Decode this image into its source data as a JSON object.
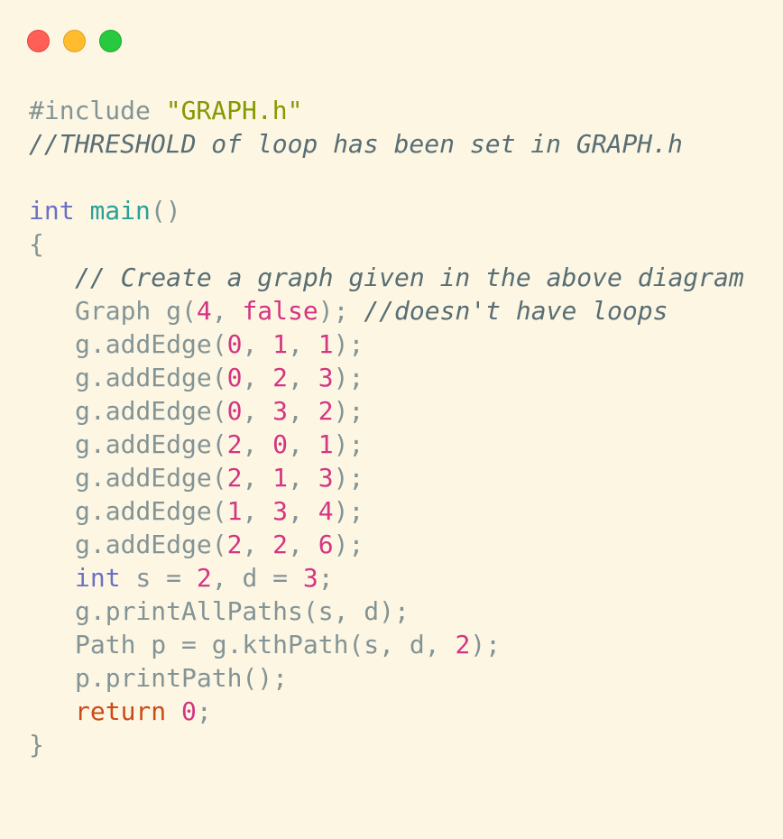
{
  "window": {
    "buttons": [
      "close",
      "minimize",
      "maximize"
    ],
    "colors": {
      "background": "#fdf6e3",
      "close": "#ff5f56",
      "minimize": "#ffbd2e",
      "maximize": "#27c93f"
    }
  },
  "code": {
    "colors": {
      "plain": "#839496",
      "string": "#859900",
      "comment": "#586e75",
      "type": "#6c71c4",
      "function": "#2aa198",
      "number": "#d33682",
      "keyword": "#cb4b16"
    },
    "lines": [
      {
        "indent": false,
        "tokens": [
          {
            "t": "#include ",
            "k": "directive"
          },
          {
            "t": "\"GRAPH.h\"",
            "k": "string"
          }
        ]
      },
      {
        "indent": false,
        "tokens": [
          {
            "t": "//THRESHOLD of loop has been set in GRAPH.h",
            "k": "comment"
          }
        ]
      },
      {
        "indent": false,
        "tokens": []
      },
      {
        "indent": false,
        "tokens": [
          {
            "t": "int",
            "k": "type"
          },
          {
            "t": " ",
            "k": "plain"
          },
          {
            "t": "main",
            "k": "func"
          },
          {
            "t": "()",
            "k": "plain"
          }
        ]
      },
      {
        "indent": false,
        "tokens": [
          {
            "t": "{",
            "k": "plain"
          }
        ]
      },
      {
        "indent": true,
        "tokens": [
          {
            "t": "// Create a graph given in the above diagram",
            "k": "comment"
          }
        ]
      },
      {
        "indent": true,
        "tokens": [
          {
            "t": "Graph g(",
            "k": "plain"
          },
          {
            "t": "4",
            "k": "number"
          },
          {
            "t": ", ",
            "k": "plain"
          },
          {
            "t": "false",
            "k": "number"
          },
          {
            "t": "); ",
            "k": "plain"
          },
          {
            "t": "//doesn't have loops",
            "k": "comment"
          }
        ]
      },
      {
        "indent": true,
        "tokens": [
          {
            "t": "g.addEdge(",
            "k": "plain"
          },
          {
            "t": "0",
            "k": "number"
          },
          {
            "t": ", ",
            "k": "plain"
          },
          {
            "t": "1",
            "k": "number"
          },
          {
            "t": ", ",
            "k": "plain"
          },
          {
            "t": "1",
            "k": "number"
          },
          {
            "t": ");",
            "k": "plain"
          }
        ]
      },
      {
        "indent": true,
        "tokens": [
          {
            "t": "g.addEdge(",
            "k": "plain"
          },
          {
            "t": "0",
            "k": "number"
          },
          {
            "t": ", ",
            "k": "plain"
          },
          {
            "t": "2",
            "k": "number"
          },
          {
            "t": ", ",
            "k": "plain"
          },
          {
            "t": "3",
            "k": "number"
          },
          {
            "t": ");",
            "k": "plain"
          }
        ]
      },
      {
        "indent": true,
        "tokens": [
          {
            "t": "g.addEdge(",
            "k": "plain"
          },
          {
            "t": "0",
            "k": "number"
          },
          {
            "t": ", ",
            "k": "plain"
          },
          {
            "t": "3",
            "k": "number"
          },
          {
            "t": ", ",
            "k": "plain"
          },
          {
            "t": "2",
            "k": "number"
          },
          {
            "t": ");",
            "k": "plain"
          }
        ]
      },
      {
        "indent": true,
        "tokens": [
          {
            "t": "g.addEdge(",
            "k": "plain"
          },
          {
            "t": "2",
            "k": "number"
          },
          {
            "t": ", ",
            "k": "plain"
          },
          {
            "t": "0",
            "k": "number"
          },
          {
            "t": ", ",
            "k": "plain"
          },
          {
            "t": "1",
            "k": "number"
          },
          {
            "t": ");",
            "k": "plain"
          }
        ]
      },
      {
        "indent": true,
        "tokens": [
          {
            "t": "g.addEdge(",
            "k": "plain"
          },
          {
            "t": "2",
            "k": "number"
          },
          {
            "t": ", ",
            "k": "plain"
          },
          {
            "t": "1",
            "k": "number"
          },
          {
            "t": ", ",
            "k": "plain"
          },
          {
            "t": "3",
            "k": "number"
          },
          {
            "t": ");",
            "k": "plain"
          }
        ]
      },
      {
        "indent": true,
        "tokens": [
          {
            "t": "g.addEdge(",
            "k": "plain"
          },
          {
            "t": "1",
            "k": "number"
          },
          {
            "t": ", ",
            "k": "plain"
          },
          {
            "t": "3",
            "k": "number"
          },
          {
            "t": ", ",
            "k": "plain"
          },
          {
            "t": "4",
            "k": "number"
          },
          {
            "t": ");",
            "k": "plain"
          }
        ]
      },
      {
        "indent": true,
        "tokens": [
          {
            "t": "g.addEdge(",
            "k": "plain"
          },
          {
            "t": "2",
            "k": "number"
          },
          {
            "t": ", ",
            "k": "plain"
          },
          {
            "t": "2",
            "k": "number"
          },
          {
            "t": ", ",
            "k": "plain"
          },
          {
            "t": "6",
            "k": "number"
          },
          {
            "t": ");",
            "k": "plain"
          }
        ]
      },
      {
        "indent": true,
        "tokens": [
          {
            "t": "int",
            "k": "type"
          },
          {
            "t": " s = ",
            "k": "plain"
          },
          {
            "t": "2",
            "k": "number"
          },
          {
            "t": ", d = ",
            "k": "plain"
          },
          {
            "t": "3",
            "k": "number"
          },
          {
            "t": ";",
            "k": "plain"
          }
        ]
      },
      {
        "indent": true,
        "tokens": [
          {
            "t": "g.printAllPaths(s, d);",
            "k": "plain"
          }
        ]
      },
      {
        "indent": true,
        "tokens": [
          {
            "t": "Path p = g.kthPath(s, d, ",
            "k": "plain"
          },
          {
            "t": "2",
            "k": "number"
          },
          {
            "t": ");",
            "k": "plain"
          }
        ]
      },
      {
        "indent": true,
        "tokens": [
          {
            "t": "p.printPath();",
            "k": "plain"
          }
        ]
      },
      {
        "indent": true,
        "tokens": [
          {
            "t": "return",
            "k": "keyword"
          },
          {
            "t": " ",
            "k": "plain"
          },
          {
            "t": "0",
            "k": "number"
          },
          {
            "t": ";",
            "k": "plain"
          }
        ]
      },
      {
        "indent": false,
        "tokens": [
          {
            "t": "}",
            "k": "plain"
          }
        ]
      }
    ]
  }
}
